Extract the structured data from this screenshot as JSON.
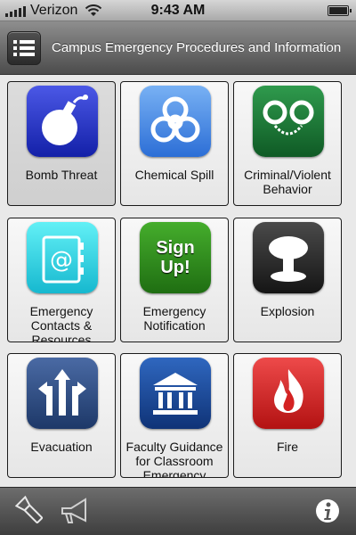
{
  "status": {
    "carrier": "Verizon",
    "time": "9:43 AM"
  },
  "header": {
    "title": "Campus Emergency Procedures and Information"
  },
  "tiles": [
    {
      "label": "Bomb Threat",
      "icon": "bomb-icon",
      "color": "#1f2ec9"
    },
    {
      "label": "Chemical Spill",
      "icon": "biohazard-icon",
      "color": "#3f86e6"
    },
    {
      "label": "Criminal/Violent Behavior",
      "icon": "handcuffs-icon",
      "color": "#1c7a3a"
    },
    {
      "label": "Emergency Contacts & Resources",
      "icon": "address-book-icon",
      "color": "#27d7e3"
    },
    {
      "label": "Emergency Notification",
      "icon": "sign-up-icon",
      "color": "#2f8f1c",
      "icon_text_1": "Sign",
      "icon_text_2": "Up!"
    },
    {
      "label": "Explosion",
      "icon": "mushroom-cloud-icon",
      "color": "#2a2a2a"
    },
    {
      "label": "Evacuation",
      "icon": "arrows-icon",
      "color": "#2f4e86"
    },
    {
      "label": "Faculty Guidance for Classroom Emergency",
      "icon": "building-icon",
      "color": "#1b4b9b"
    },
    {
      "label": "Fire",
      "icon": "flame-icon",
      "color": "#d42222"
    }
  ],
  "toolbar": {
    "left_icon": "flashlight-icon",
    "middle_icon": "megaphone-icon",
    "right_icon": "info-icon"
  }
}
